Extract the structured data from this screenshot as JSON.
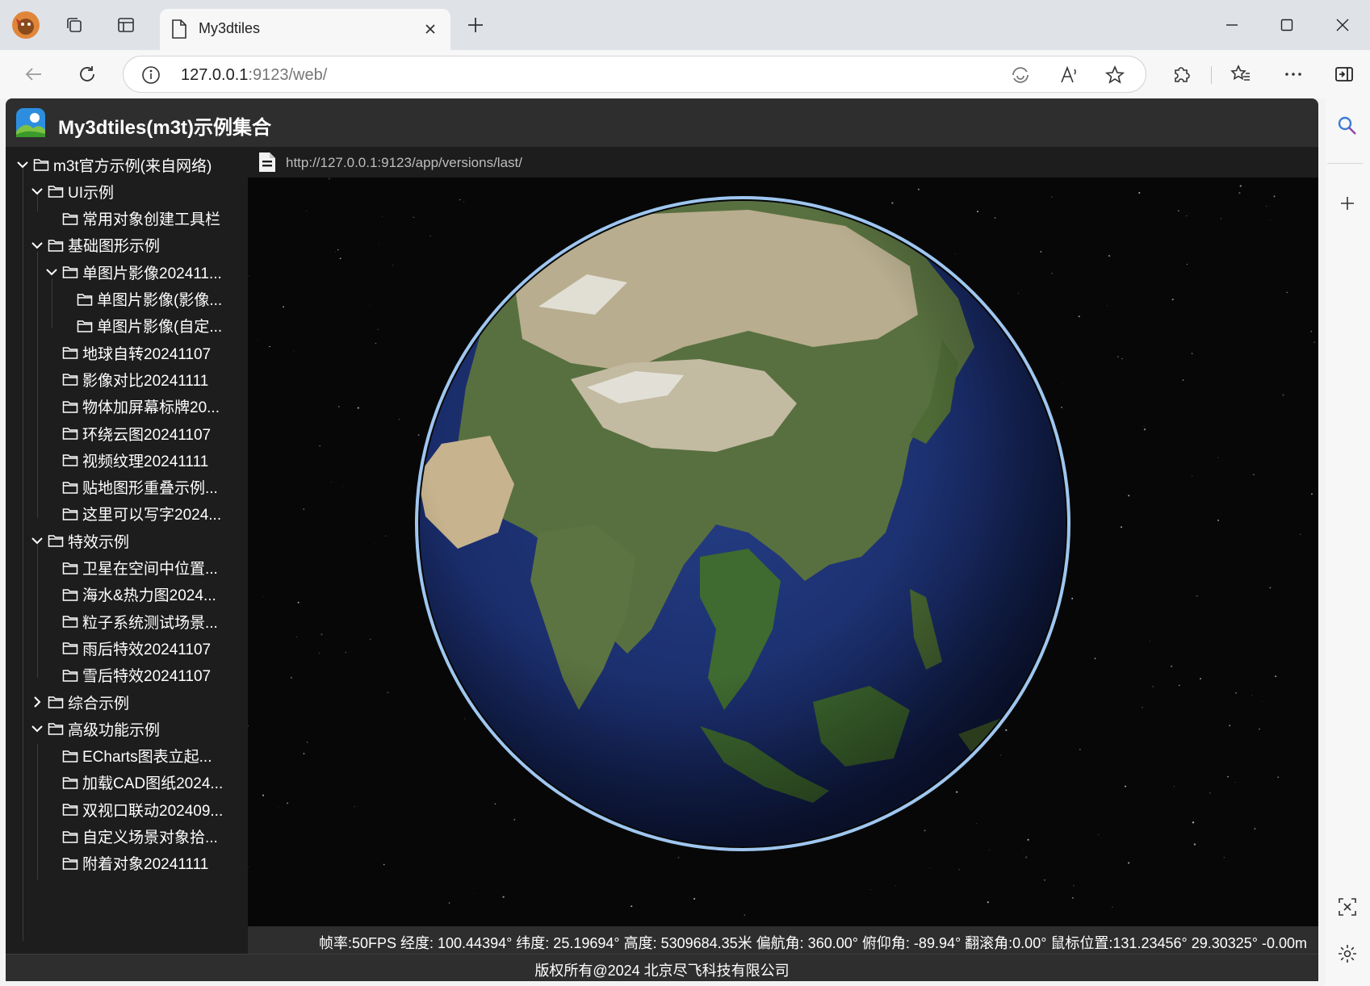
{
  "browser": {
    "tab_title": "My3dtiles",
    "address_host": "127.0.0.1",
    "address_rest": ":9123/web/"
  },
  "app": {
    "title": "My3dtiles(m3t)示例集合",
    "iframe_url": "http://127.0.0.1:9123/app/versions/last/",
    "status": "帧率:50FPS 经度: 100.44394° 纬度: 25.19694° 高度: 5309684.35米 偏航角: 360.00° 俯仰角: -89.94° 翻滚角:0.00° 鼠标位置:131.23456° 29.30325° -0.00m",
    "footer": "版权所有@2024 北京尽飞科技有限公司"
  },
  "tree": [
    {
      "label": "m3t官方示例(来自网络)",
      "expanded": true
    },
    {
      "label": "UI示例",
      "expanded": true
    },
    {
      "label": "常用对象创建工具栏"
    },
    {
      "label": "基础图形示例",
      "expanded": true
    },
    {
      "label": "单图片影像202411...",
      "expanded": true
    },
    {
      "label": "单图片影像(影像..."
    },
    {
      "label": "单图片影像(自定..."
    },
    {
      "label": "地球自转20241107"
    },
    {
      "label": "影像对比20241111"
    },
    {
      "label": "物体加屏幕标牌20..."
    },
    {
      "label": "环绕云图20241107"
    },
    {
      "label": "视频纹理20241111"
    },
    {
      "label": "贴地图形重叠示例..."
    },
    {
      "label": "这里可以写字2024..."
    },
    {
      "label": "特效示例",
      "expanded": true
    },
    {
      "label": "卫星在空间中位置..."
    },
    {
      "label": "海水&热力图2024..."
    },
    {
      "label": "粒子系统测试场景..."
    },
    {
      "label": "雨后特效20241107"
    },
    {
      "label": "雪后特效20241107"
    },
    {
      "label": "综合示例",
      "expanded": false
    },
    {
      "label": "高级功能示例",
      "expanded": true
    },
    {
      "label": "ECharts图表立起..."
    },
    {
      "label": "加载CAD图纸2024..."
    },
    {
      "label": "双视口联动202409..."
    },
    {
      "label": "自定义场景对象拾..."
    },
    {
      "label": "附着对象20241111"
    }
  ],
  "colors": {
    "header_bg": "#2e2e2e",
    "tree_bg": "#1d1d1d",
    "ocean": "#1a2d6b",
    "land": "#4f6b3a",
    "desert": "#b5a88a"
  }
}
